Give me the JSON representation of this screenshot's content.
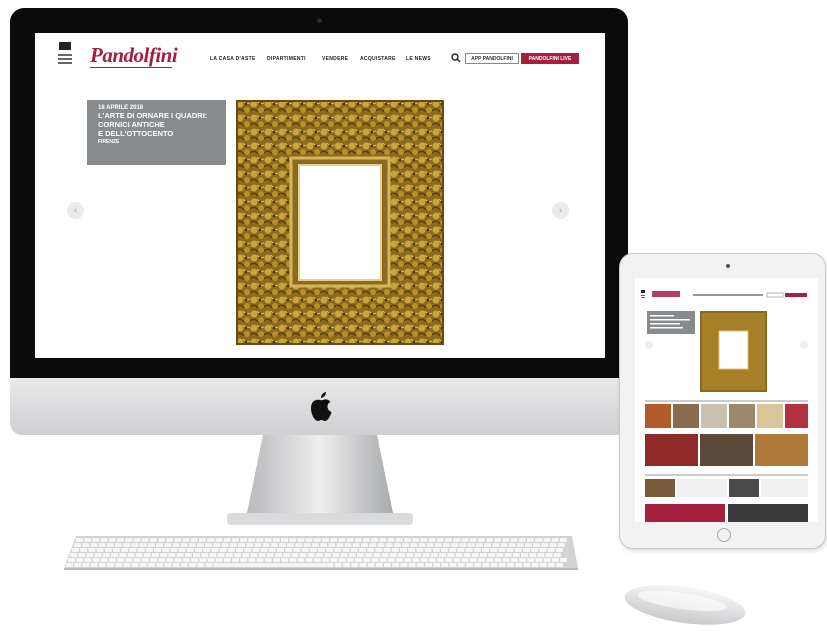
{
  "site": {
    "logo": "Pandolfini",
    "nav": [
      "LA CASA D'ASTE",
      "DIPARTIMENTI",
      "VENDERE",
      "ACQUISTARE",
      "LE NEWS"
    ],
    "app_button": "APP PANDOLFINI",
    "live_button": "PANDOLFINI LIVE"
  },
  "hero": {
    "date": "18 APRILE 2018",
    "title_lines": [
      "L'ARTE DI ORNARE I QUADRI:",
      "CORNICI ANTICHE",
      "E DELL'OTTOCENTO"
    ],
    "city": "FIRENZE",
    "prev_arrow": "‹",
    "next_arrow": "›"
  },
  "colors": {
    "brand": "#a3203f",
    "caption_bg": "#888b8d",
    "bezel": "#0b0b0b"
  },
  "icons": {
    "menu": "hamburger-icon",
    "search": "search-icon",
    "apple": "apple-logo-icon"
  }
}
